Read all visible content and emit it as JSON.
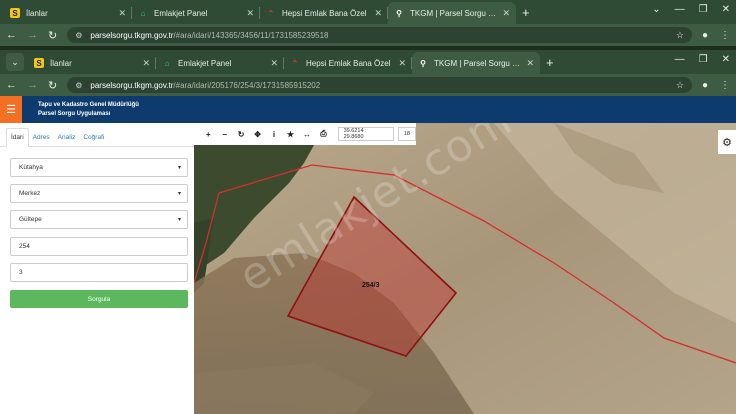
{
  "outer_window": {
    "tabs": [
      {
        "label": "İlanlar",
        "favicon": "S",
        "favicon_color": "#f5c518",
        "active": false
      },
      {
        "label": "Emlakjet Panel",
        "favicon": "house-icon",
        "favicon_color": "#2ecc71",
        "active": false
      },
      {
        "label": "Hepsi Emlak Bana Özel",
        "favicon": "roof-icon",
        "favicon_color": "#e53935",
        "active": false
      },
      {
        "label": "TKGM | Parsel Sorgu Uygulaması",
        "favicon": "location-pin-icon",
        "favicon_color": "#ffffff",
        "active": true
      }
    ],
    "url_host": "parselsorgu.tkgm.gov.tr",
    "url_path": "/#ara/idari/143365/3456/11/1731585239518"
  },
  "inner_window": {
    "tabs": [
      {
        "label": "İlanlar",
        "favicon": "S",
        "favicon_color": "#f5c518",
        "active": false
      },
      {
        "label": "Emlakjet Panel",
        "favicon": "house-icon",
        "favicon_color": "#2ecc71",
        "active": false
      },
      {
        "label": "Hepsi Emlak Bana Özel",
        "favicon": "roof-icon",
        "favicon_color": "#e53935",
        "active": false
      },
      {
        "label": "TKGM | Parsel Sorgu Uygulaması",
        "favicon": "location-pin-icon",
        "favicon_color": "#ffffff",
        "active": true
      }
    ],
    "url_host": "parselsorgu.tkgm.gov.tr",
    "url_path": "/#ara/idari/205176/254/3/1731585915202"
  },
  "header": {
    "line1": "Tapu ve Kadastro Genel Müdürlüğü",
    "line2": "Parsel Sorgu Uygulaması",
    "colors": {
      "bar": "#0d3b6e",
      "menu": "#f36f21"
    }
  },
  "sidebar": {
    "tabs": [
      "İdari",
      "Adres",
      "Analiz",
      "Coğrafi"
    ],
    "active_tab": "İdari",
    "il": "Kütahya",
    "ilce": "Merkez",
    "mahalle": "Gültepe",
    "ada": "254",
    "parsel": "3",
    "query_button": "Sorgula",
    "button_color": "#5cb85c"
  },
  "map": {
    "coordinates": "39.6214 : 29.8680",
    "zoom": "18",
    "parcel_label": "254/3",
    "watermark": "emlakjet.com",
    "tool_icons": [
      "zoom-in-icon",
      "zoom-out-icon",
      "refresh-icon",
      "locate-icon",
      "info-icon",
      "star-icon",
      "measure-icon",
      "print-icon"
    ],
    "parcel_color": "#c62828"
  }
}
